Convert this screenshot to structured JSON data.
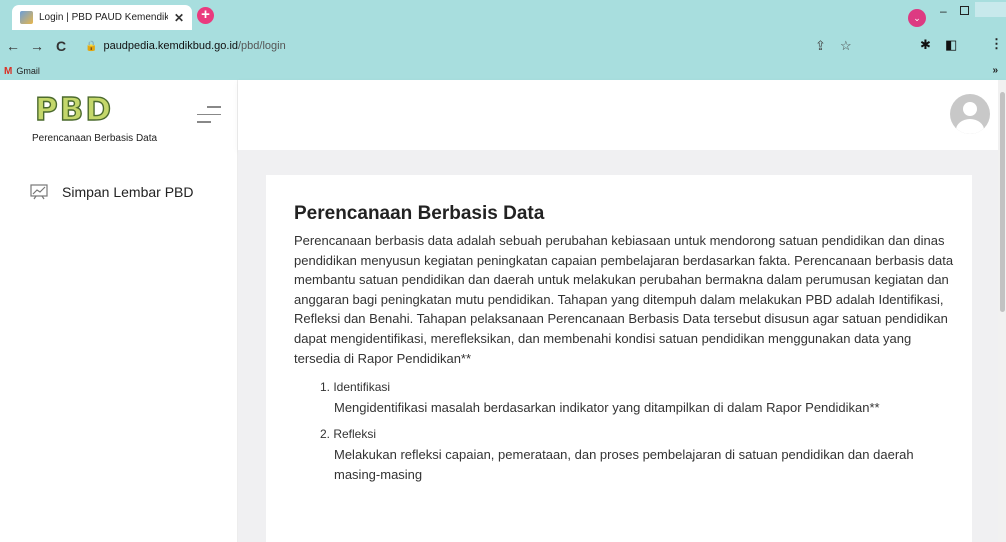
{
  "browser": {
    "tab_title": "Login | PBD PAUD Kemendikbud",
    "new_tab": "+",
    "url_host": "paudpedia.kemdikbud.go.id",
    "url_path": "/pbd/login",
    "bookmark_gmail": "Gmail",
    "bookmarks_more": "»"
  },
  "sidebar": {
    "logo": "PBD",
    "logo_subtitle": "Perencanaan Berbasis Data",
    "items": [
      {
        "label": "Simpan Lembar PBD"
      }
    ]
  },
  "content": {
    "title": "Perencanaan Berbasis Data",
    "body": "Perencanaan berbasis data adalah sebuah perubahan kebiasaan untuk mendorong satuan pendidikan dan dinas pendidikan menyusun kegiatan peningkatan capaian pembelajaran berdasarkan fakta. Perencanaan berbasis data membantu satuan pendidikan dan daerah untuk melakukan perubahan bermakna dalam perumusan kegiatan dan anggaran bagi peningkatan mutu pendidikan. Tahapan yang ditempuh dalam melakukan PBD adalah Identifikasi, Refleksi dan Benahi. Tahapan pelaksanaan Perencanaan Berbasis Data tersebut disusun agar satuan pendidikan dapat mengidentifikasi, merefleksikan, dan membenahi kondisi satuan pendidikan menggunakan data yang tersedia di Rapor Pendidikan**",
    "steps": [
      {
        "heading": "1. Identifikasi",
        "description": "Mengidentifikasi masalah berdasarkan indikator yang ditampilkan di dalam Rapor Pendidikan**"
      },
      {
        "heading": "2. Refleksi",
        "description": "Melakukan refleksi capaian, pemerataan, dan proses pembelajaran di satuan pendidikan dan daerah masing-masing"
      }
    ]
  },
  "colors": {
    "chrome": "#a8dede",
    "logo_fill": "#c4d76b",
    "logo_stroke": "#4b6a2e",
    "page_bg": "#f0f0f2"
  }
}
